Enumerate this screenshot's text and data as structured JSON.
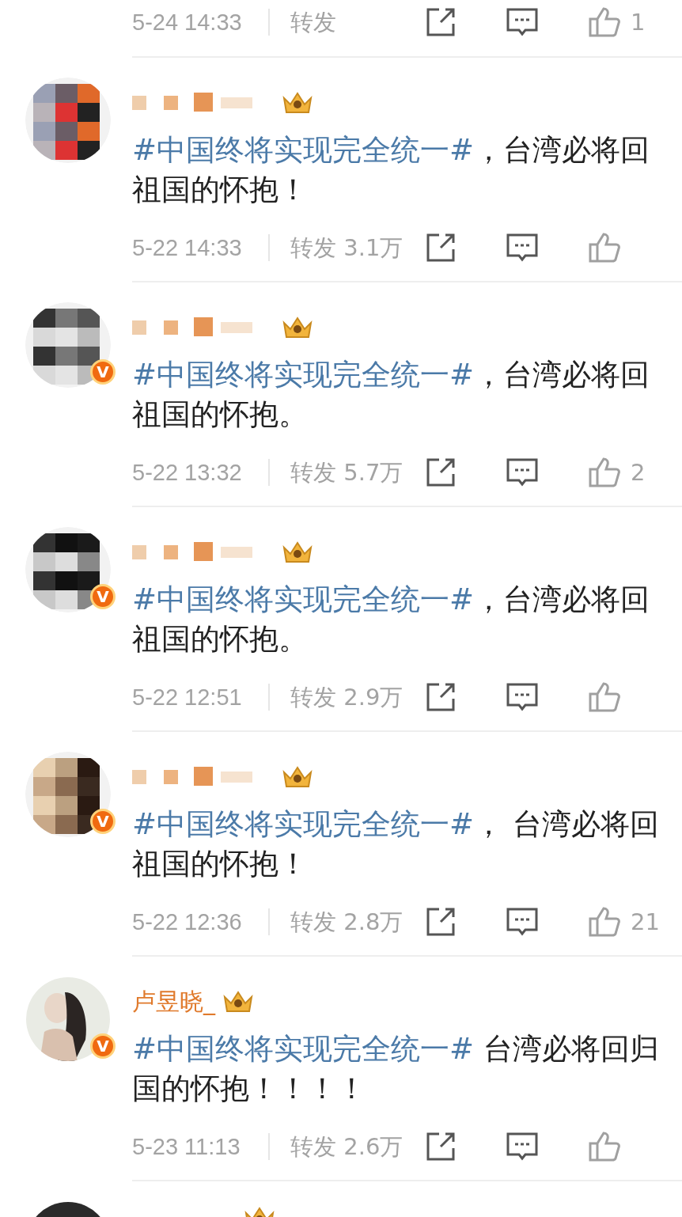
{
  "posts": [
    {
      "kind": "footer_only",
      "time": "5-24 14:33",
      "repost": "转发",
      "likes": "1"
    },
    {
      "kind": "full",
      "crown": true,
      "hashtag": "#中国终将实现完全统一#",
      "text": "，台湾必将回",
      "text_line2": "祖国的怀抱！",
      "time": "5-22 14:33",
      "repost": "转发 3.1万"
    },
    {
      "kind": "full",
      "crown": true,
      "verified_badge": "V",
      "hashtag": "#中国终将实现完全统一#",
      "text": "，台湾必将回",
      "text_line2": "祖国的怀抱。",
      "time": "5-22 13:32",
      "repost": "转发 5.7万",
      "likes": "2"
    },
    {
      "kind": "full",
      "crown": true,
      "verified_badge": "V",
      "hashtag": "#中国终将实现完全统一#",
      "text": "，台湾必将回",
      "text_line2": "祖国的怀抱。",
      "time": "5-22 12:51",
      "repost": "转发 2.9万"
    },
    {
      "kind": "full",
      "crown": true,
      "verified_badge": "V",
      "hashtag": "#中国终将实现完全统一#",
      "text": "， 台湾必将回",
      "text_line2": "祖国的怀抱！",
      "time": "5-22 12:36",
      "repost": "转发 2.8万",
      "likes": "21"
    },
    {
      "kind": "full",
      "name": "卢昱晓_",
      "crown": true,
      "verified_badge": "V",
      "hashtag": "#中国终将实现完全统一#",
      "text": " 台湾必将回归",
      "text_line2": "国的怀抱！！！！",
      "time": "5-23 11:13",
      "repost": "转发 2.6万"
    },
    {
      "kind": "cut",
      "crown": true
    }
  ]
}
